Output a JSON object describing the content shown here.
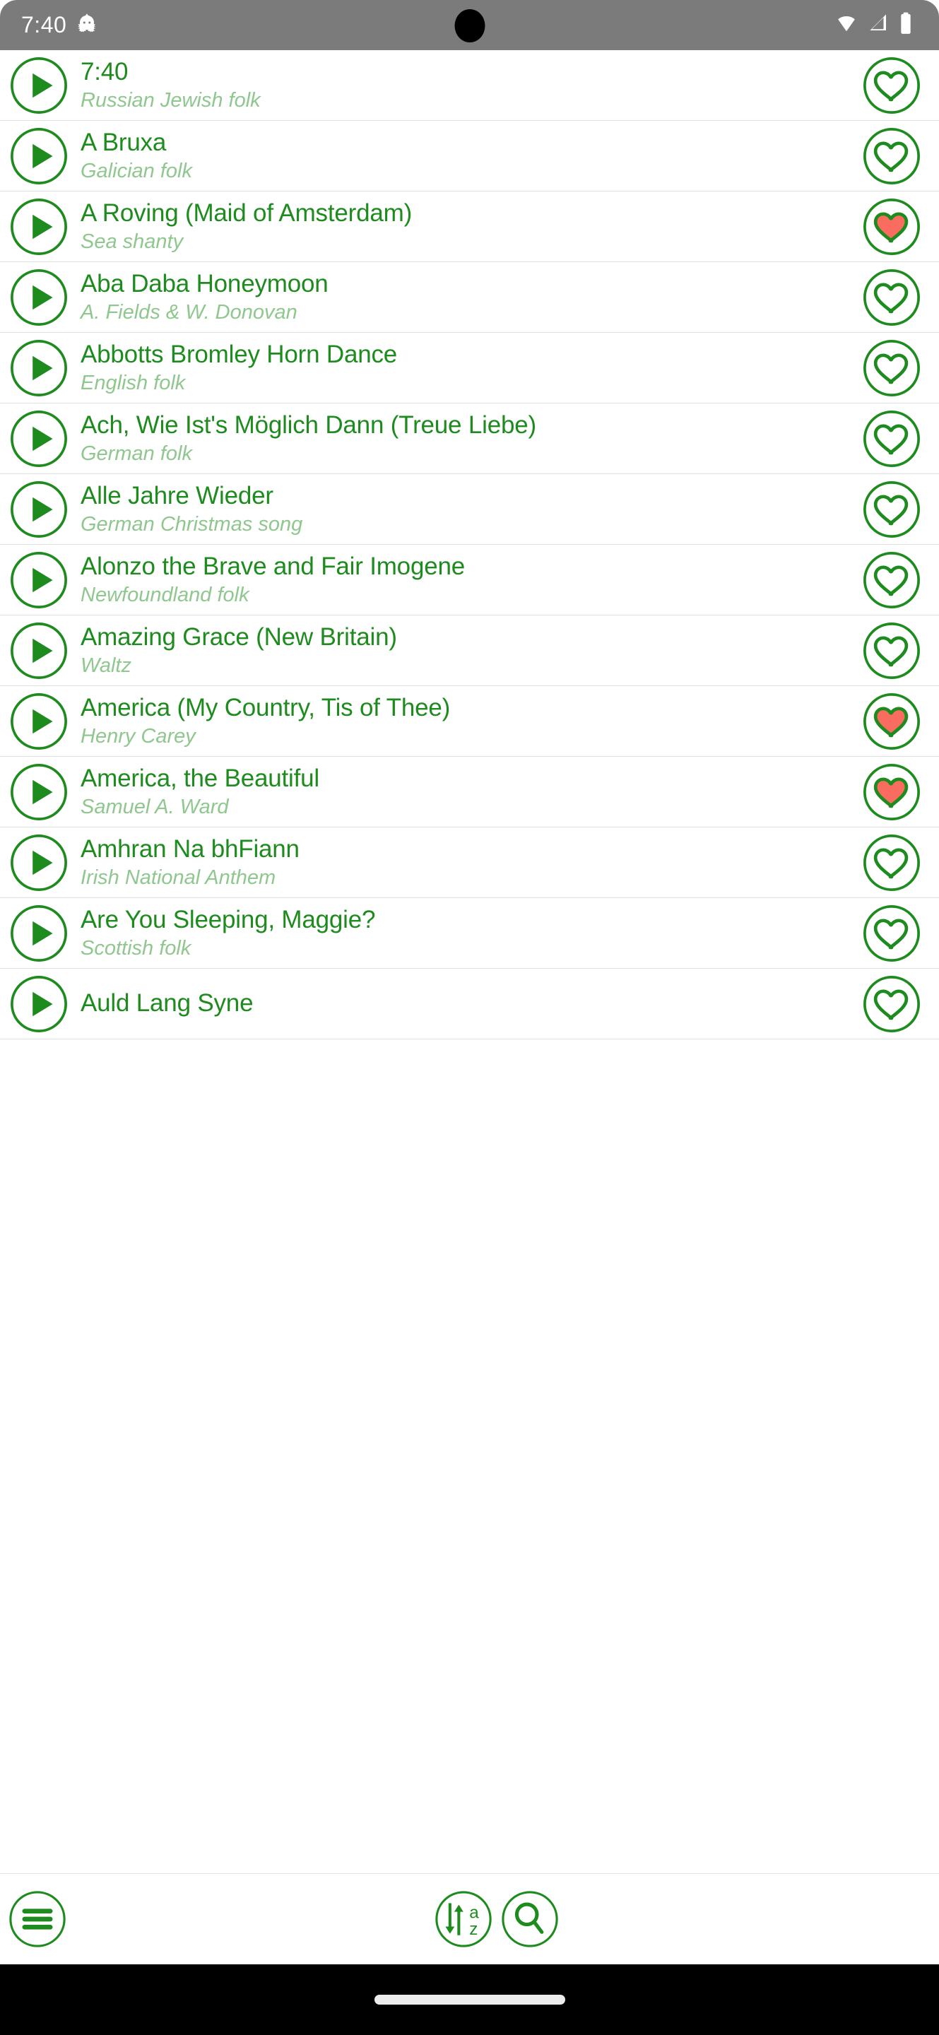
{
  "status_bar": {
    "time": "7:40",
    "icons": [
      "android-debug-icon",
      "wifi-icon",
      "signal-icon",
      "battery-icon"
    ]
  },
  "colors": {
    "green": "#1e8b1e",
    "green_light": "#8fc78f",
    "heart_filled": "#fa6b60",
    "statusbar_bg": "#7b7b7b",
    "divider": "#e2e2e2"
  },
  "songs": [
    {
      "title": "7:40",
      "subtitle": "Russian Jewish folk",
      "favorited": false
    },
    {
      "title": "A Bruxa",
      "subtitle": "Galician folk",
      "favorited": false
    },
    {
      "title": "A Roving (Maid of Amsterdam)",
      "subtitle": "Sea shanty",
      "favorited": true
    },
    {
      "title": "Aba Daba Honeymoon",
      "subtitle": "A. Fields & W. Donovan",
      "favorited": false
    },
    {
      "title": "Abbotts Bromley Horn Dance",
      "subtitle": "English folk",
      "favorited": false
    },
    {
      "title": "Ach, Wie Ist's Möglich Dann (Treue Liebe)",
      "subtitle": "German folk",
      "favorited": false
    },
    {
      "title": "Alle Jahre Wieder",
      "subtitle": "German Christmas song",
      "favorited": false
    },
    {
      "title": "Alonzo the Brave and Fair Imogene",
      "subtitle": "Newfoundland folk",
      "favorited": false
    },
    {
      "title": "Amazing Grace (New Britain)",
      "subtitle": "Waltz",
      "favorited": false
    },
    {
      "title": "America (My Country, Tis of Thee)",
      "subtitle": "Henry Carey",
      "favorited": true
    },
    {
      "title": "America, the Beautiful",
      "subtitle": "Samuel A. Ward",
      "favorited": true
    },
    {
      "title": "Amhran Na bhFiann",
      "subtitle": "Irish National Anthem",
      "favorited": false
    },
    {
      "title": "Are You Sleeping, Maggie?",
      "subtitle": "Scottish folk",
      "favorited": false
    },
    {
      "title": "Auld Lang Syne",
      "subtitle": "",
      "favorited": false
    }
  ],
  "bottom_nav": [
    {
      "name": "menu-button",
      "icon": "hamburger-menu-icon",
      "label": "Menu"
    },
    {
      "name": "sort-button",
      "icon": "sort-az-icon",
      "label": "Sort A-Z"
    },
    {
      "name": "search-button",
      "icon": "search-icon",
      "label": "Search"
    }
  ]
}
